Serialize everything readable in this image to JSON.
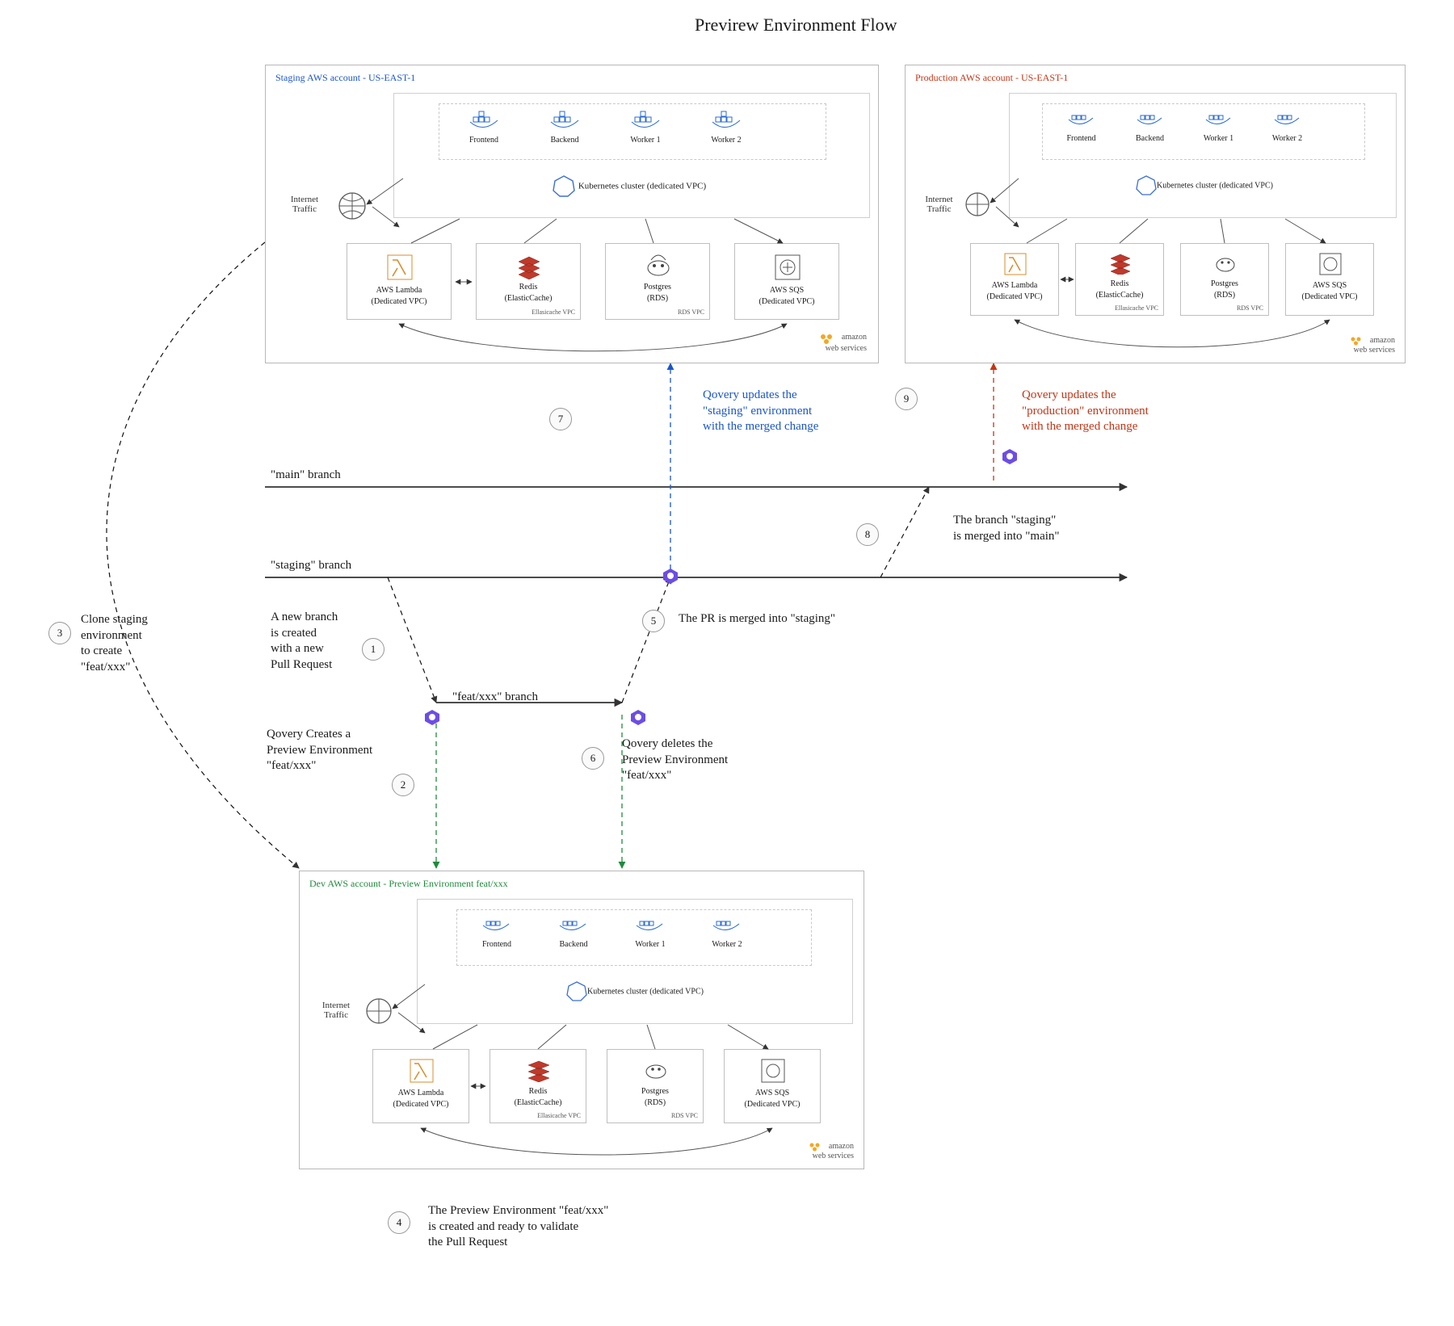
{
  "title": "Previrew Environment Flow",
  "envs": {
    "staging": {
      "title": "Staging AWS account - US-EAST-1",
      "title_color": "#1b56c9",
      "pods": [
        "Frontend",
        "Backend",
        "Worker 1",
        "Worker 2"
      ],
      "k8s": "Kubernetes cluster (dedicated VPC)",
      "internet_traffic": "Internet\nTraffic",
      "svcs": {
        "lambda": {
          "name": "AWS Lambda",
          "sub": "(Dedicated VPC)"
        },
        "redis": {
          "name": "Redis",
          "sub": "(ElasticCache)",
          "vpc": "Ellasicache VPC"
        },
        "pg": {
          "name": "Postgres",
          "sub": "(RDS)",
          "vpc": "RDS VPC"
        },
        "sqs": {
          "name": "AWS SQS",
          "sub": "(Dedicated VPC)"
        }
      },
      "amazon": "amazon\nweb services"
    },
    "prod": {
      "title": "Production AWS account - US-EAST-1",
      "title_color": "#c23616",
      "pods": [
        "Frontend",
        "Backend",
        "Worker 1",
        "Worker 2"
      ],
      "k8s": "Kubernetes cluster (dedicated VPC)",
      "internet_traffic": "Internet\nTraffic",
      "svcs": {
        "lambda": {
          "name": "AWS Lambda",
          "sub": "(Dedicated VPC)"
        },
        "redis": {
          "name": "Redis",
          "sub": "(ElasticCache)",
          "vpc": "Ellasicache VPC"
        },
        "pg": {
          "name": "Postgres",
          "sub": "(RDS)",
          "vpc": "RDS VPC"
        },
        "sqs": {
          "name": "AWS SQS",
          "sub": "(Dedicated VPC)"
        }
      },
      "amazon": "amazon\nweb services"
    },
    "dev": {
      "title": "Dev AWS account - Preview Environment feat/xxx",
      "title_color": "#1e8b3b",
      "pods": [
        "Frontend",
        "Backend",
        "Worker 1",
        "Worker 2"
      ],
      "k8s": "Kubernetes cluster (dedicated VPC)",
      "internet_traffic": "Internet\nTraffic",
      "svcs": {
        "lambda": {
          "name": "AWS Lambda",
          "sub": "(Dedicated VPC)"
        },
        "redis": {
          "name": "Redis",
          "sub": "(ElasticCache)",
          "vpc": "Ellasicache VPC"
        },
        "pg": {
          "name": "Postgres",
          "sub": "(RDS)",
          "vpc": "RDS VPC"
        },
        "sqs": {
          "name": "AWS SQS",
          "sub": "(Dedicated VPC)"
        }
      },
      "amazon": "amazon\nweb services"
    }
  },
  "branches": {
    "main": "\"main\" branch",
    "staging": "\"staging\" branch",
    "feat": "\"feat/xxx\" branch"
  },
  "steps": {
    "1": "A new branch\nis created\nwith a new\nPull Request",
    "2": "Qovery Creates a\nPreview Environment\n\"feat/xxx\"",
    "3": "Clone staging\nenvironment\nto create\n\"feat/xxx\"",
    "4": "The Preview Environment \"feat/xxx\"\nis created and ready to validate\nthe Pull Request",
    "5": "The PR is merged into \"staging\"",
    "6": "Qovery deletes the\nPreview Environment\n\"feat/xxx\"",
    "7": "Qovery updates the\n\"staging\" environment\nwith the merged change",
    "8": "The branch \"staging\"\nis merged into \"main\"",
    "9": "Qovery updates the\n\"production\" environment\nwith the merged change"
  },
  "chart_data": {
    "type": "diagram",
    "title": "Previrew Environment Flow",
    "accounts": [
      {
        "id": "staging",
        "label": "Staging AWS account - US-EAST-1",
        "apps": [
          "Frontend",
          "Backend",
          "Worker 1",
          "Worker 2"
        ],
        "services": [
          "AWS Lambda",
          "Redis (ElasticCache)",
          "Postgres (RDS)",
          "AWS SQS"
        ]
      },
      {
        "id": "production",
        "label": "Production AWS account - US-EAST-1",
        "apps": [
          "Frontend",
          "Backend",
          "Worker 1",
          "Worker 2"
        ],
        "services": [
          "AWS Lambda",
          "Redis (ElasticCache)",
          "Postgres (RDS)",
          "AWS SQS"
        ]
      },
      {
        "id": "dev",
        "label": "Dev AWS account - Preview Environment feat/xxx",
        "apps": [
          "Frontend",
          "Backend",
          "Worker 1",
          "Worker 2"
        ],
        "services": [
          "AWS Lambda",
          "Redis (ElasticCache)",
          "Postgres (RDS)",
          "AWS SQS"
        ]
      }
    ],
    "branches": [
      "main",
      "staging",
      "feat/xxx"
    ],
    "flow_steps": [
      {
        "n": 1,
        "text": "A new branch is created with a new Pull Request",
        "from": "staging branch",
        "to": "feat/xxx branch"
      },
      {
        "n": 2,
        "text": "Qovery Creates a Preview Environment \"feat/xxx\"",
        "from": "feat/xxx branch",
        "to": "dev account"
      },
      {
        "n": 3,
        "text": "Clone staging environment to create \"feat/xxx\"",
        "from": "staging account",
        "to": "dev account"
      },
      {
        "n": 4,
        "text": "The Preview Environment \"feat/xxx\" is created and ready to validate the Pull Request",
        "at": "dev account"
      },
      {
        "n": 5,
        "text": "The PR is merged into \"staging\"",
        "from": "feat/xxx branch",
        "to": "staging branch"
      },
      {
        "n": 6,
        "text": "Qovery deletes the Preview Environment \"feat/xxx\"",
        "from": "feat/xxx branch",
        "to": "dev account"
      },
      {
        "n": 7,
        "text": "Qovery updates the \"staging\" environment with the merged change",
        "from": "staging branch",
        "to": "staging account"
      },
      {
        "n": 8,
        "text": "The branch \"staging\" is merged into \"main\"",
        "from": "staging branch",
        "to": "main branch"
      },
      {
        "n": 9,
        "text": "Qovery updates the \"production\" environment with the merged change",
        "from": "main branch",
        "to": "production account"
      }
    ]
  }
}
